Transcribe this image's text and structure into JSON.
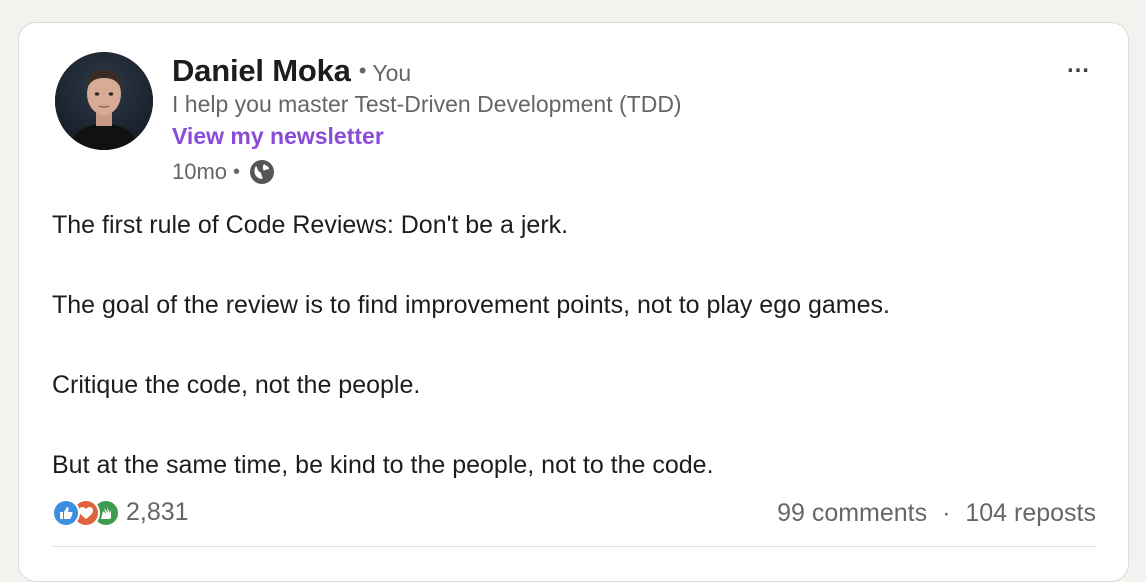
{
  "post": {
    "author": {
      "name": "Daniel Moka",
      "separator": "•",
      "degree": "You",
      "headline": "I help you master Test-Driven Development (TDD)",
      "newsletter_link": "View my newsletter"
    },
    "meta": {
      "time": "10mo",
      "separator": "•",
      "visibility_icon": "globe-icon"
    },
    "menu_label": "…",
    "body": [
      "The first rule of Code Reviews: Don't be a jerk.",
      "The goal of the review is to find improvement points, not to play ego games.",
      "Critique the code, not the people.",
      "But at the same time, be kind to the people, not to the code."
    ],
    "reactions": {
      "icons": [
        "like-icon",
        "love-icon",
        "celebrate-icon"
      ],
      "count": "2,831"
    },
    "stats": {
      "comments": "99 comments",
      "separator": "·",
      "reposts": "104 reposts"
    },
    "colors": {
      "newsletter_link": "#8a4bd6",
      "like": "#3b8fe0",
      "love": "#e0623d",
      "celebrate": "#3f9b52"
    }
  }
}
